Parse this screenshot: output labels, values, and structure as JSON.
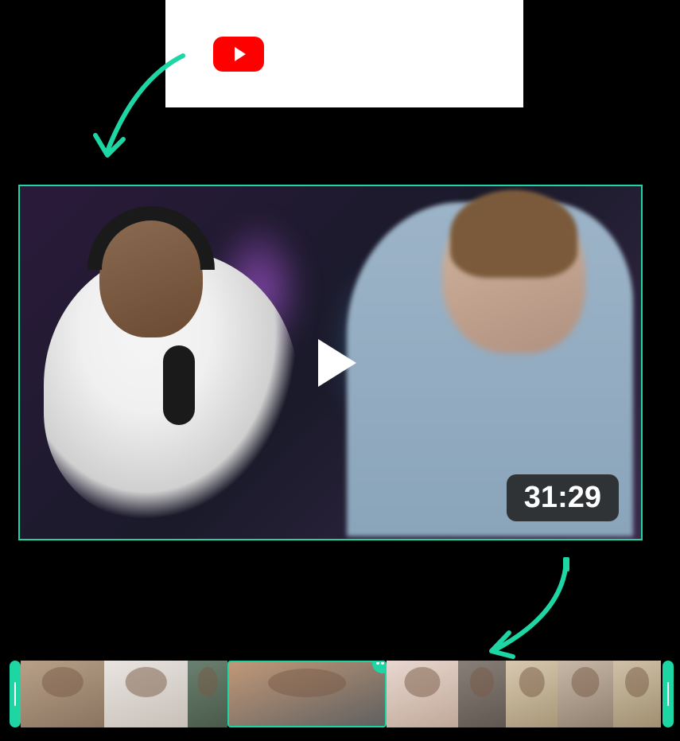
{
  "source": {
    "platform": "YouTube"
  },
  "video": {
    "duration": "31:29"
  },
  "timeline": {
    "clips_count": 9,
    "selected_clip_index": 3
  },
  "colors": {
    "accent": "#1dd6a4",
    "youtube_red": "#ff0000"
  }
}
